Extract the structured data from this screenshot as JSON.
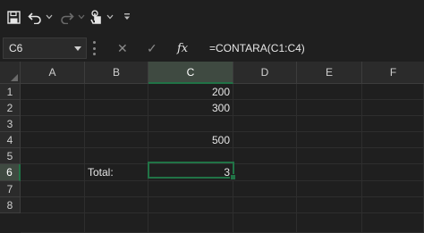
{
  "toolbar": {
    "items": [
      "save-icon",
      "undo-icon",
      "undo-dropdown-icon",
      "redo-icon",
      "redo-dropdown-icon",
      "touch-mode-icon",
      "touch-dropdown-icon",
      "customize-toolbar-icon"
    ]
  },
  "formula_bar": {
    "name_box": "C6",
    "cancel_glyph": "✕",
    "enter_glyph": "✓",
    "fx_label": "fx",
    "formula": "=CONTARA(C1:C4)"
  },
  "sheet": {
    "columns": [
      "A",
      "B",
      "C",
      "D",
      "E",
      "F"
    ],
    "rows": [
      "1",
      "2",
      "3",
      "4",
      "5",
      "6",
      "7",
      "8"
    ],
    "active_cell": "C6",
    "cells": {
      "C1": "200",
      "C2": "300",
      "C3": "",
      "C4": "500",
      "B6": "Total:",
      "C6": "3"
    }
  },
  "colors": {
    "background": "#1f1f1f",
    "header": "#2b2b2b",
    "accent": "#217346"
  }
}
